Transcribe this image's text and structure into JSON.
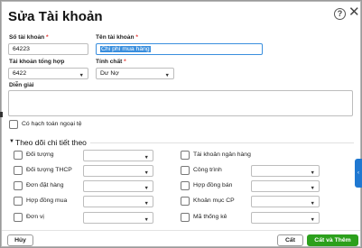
{
  "dialog": {
    "title": "Sửa Tài khoản",
    "help_icon": "?",
    "close_icon": "✕"
  },
  "form": {
    "account_number": {
      "label": "Số tài khoản",
      "required": "*",
      "value": "64223"
    },
    "account_name": {
      "label": "Tên tài khoản",
      "required": "*",
      "value": "Chi phí mua hàng"
    },
    "parent_account": {
      "label": "Tài khoản tổng hợp",
      "value": "6422"
    },
    "nature": {
      "label": "Tính chất",
      "required": "*",
      "value": "Dư Nợ"
    },
    "description": {
      "label": "Diễn giải",
      "value": ""
    },
    "foreign_currency": {
      "label": "Có hạch toán ngoại tệ",
      "checked": false
    }
  },
  "detail_section": {
    "toggle_icon": "▼",
    "title": "Theo dõi chi tiết theo",
    "left_items": [
      {
        "label": "Đối tượng",
        "checked": false,
        "value": ""
      },
      {
        "label": "Đối tượng THCP",
        "checked": false,
        "value": ""
      },
      {
        "label": "Đơn đặt hàng",
        "checked": false,
        "value": ""
      },
      {
        "label": "Hợp đồng mua",
        "checked": false,
        "value": ""
      },
      {
        "label": "Đơn vị",
        "checked": false,
        "value": ""
      }
    ],
    "right_items": [
      {
        "label": "Tài khoản ngân hàng",
        "checked": false,
        "has_select": false,
        "value": ""
      },
      {
        "label": "Công trình",
        "checked": false,
        "has_select": true,
        "value": ""
      },
      {
        "label": "Hợp đồng bán",
        "checked": false,
        "has_select": true,
        "value": ""
      },
      {
        "label": "Khoản mục CP",
        "checked": false,
        "has_select": true,
        "value": ""
      },
      {
        "label": "Mã thống kê",
        "checked": false,
        "has_select": true,
        "value": ""
      }
    ],
    "dropdown_arrow": "▼"
  },
  "footer": {
    "cancel_label": "Hủy",
    "save_label": "Cất",
    "save_add_label": "Cất và Thêm"
  },
  "side_tab": {
    "icon": "‹"
  },
  "colors": {
    "primary": "#2ca01c",
    "focus": "#3a8fde",
    "side_tab": "#1f78d1",
    "required": "#e53935"
  }
}
